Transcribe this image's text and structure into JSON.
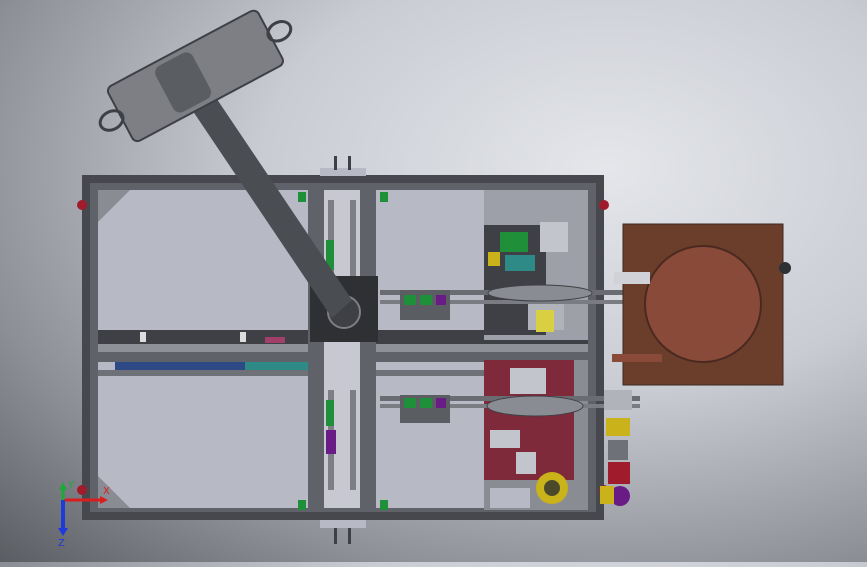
{
  "viewport": {
    "background_top": "#e4e6ea",
    "background_edge": "#5a5d62"
  },
  "colors": {
    "frame": "#5f6268",
    "frame_dark": "#3e4045",
    "panel": "#b7b9c4",
    "panel_light": "#c7c8d1",
    "arm": "#4a4d52",
    "arm_head": "#7d7f84",
    "motor_box": "#6b3e2c",
    "motor_disk": "#8a4a3a",
    "accent_green": "#1f8f3a",
    "accent_red": "#a01c2c",
    "accent_yellow": "#c9b21a",
    "accent_purple": "#6a1c86",
    "belt": "#2e4a86",
    "dark_maroon": "#7e2a3a"
  },
  "triad": {
    "x_label": "X",
    "y_label": "Y",
    "x_color": "#d81e1e",
    "y_color": "#1fa83a",
    "z_color": "#1e3adb",
    "z_label": "Z"
  }
}
